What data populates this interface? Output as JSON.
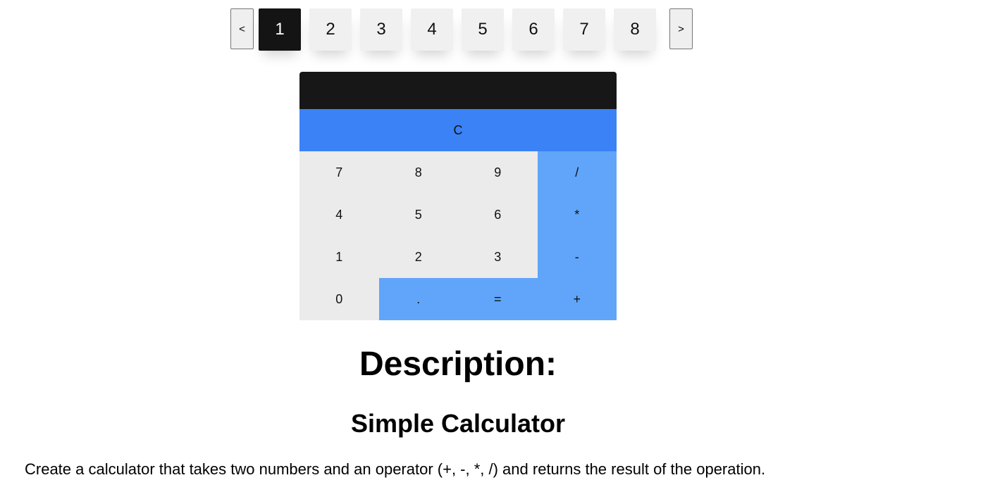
{
  "pagination": {
    "prev_label": "<",
    "next_label": ">",
    "pages": [
      "1",
      "2",
      "3",
      "4",
      "5",
      "6",
      "7",
      "8"
    ],
    "active_page": "1"
  },
  "calculator": {
    "display_value": "",
    "clear_label": "C",
    "keys": [
      {
        "label": "7",
        "type": "digit"
      },
      {
        "label": "8",
        "type": "digit"
      },
      {
        "label": "9",
        "type": "digit"
      },
      {
        "label": "/",
        "type": "op"
      },
      {
        "label": "4",
        "type": "digit"
      },
      {
        "label": "5",
        "type": "digit"
      },
      {
        "label": "6",
        "type": "digit"
      },
      {
        "label": "*",
        "type": "op"
      },
      {
        "label": "1",
        "type": "digit"
      },
      {
        "label": "2",
        "type": "digit"
      },
      {
        "label": "3",
        "type": "digit"
      },
      {
        "label": "-",
        "type": "op"
      },
      {
        "label": "0",
        "type": "digit"
      },
      {
        "label": ".",
        "type": "op"
      },
      {
        "label": "=",
        "type": "op"
      },
      {
        "label": "+",
        "type": "op"
      }
    ],
    "colors": {
      "display": "#171717",
      "clear": "#3b82f6",
      "op": "#60a5fa",
      "digit": "#ebebeb"
    }
  },
  "description": {
    "title": "Description:",
    "subtitle": "Simple Calculator",
    "text": "Create a calculator that takes two numbers and an operator (+, -, *, /) and returns the result of the operation."
  }
}
